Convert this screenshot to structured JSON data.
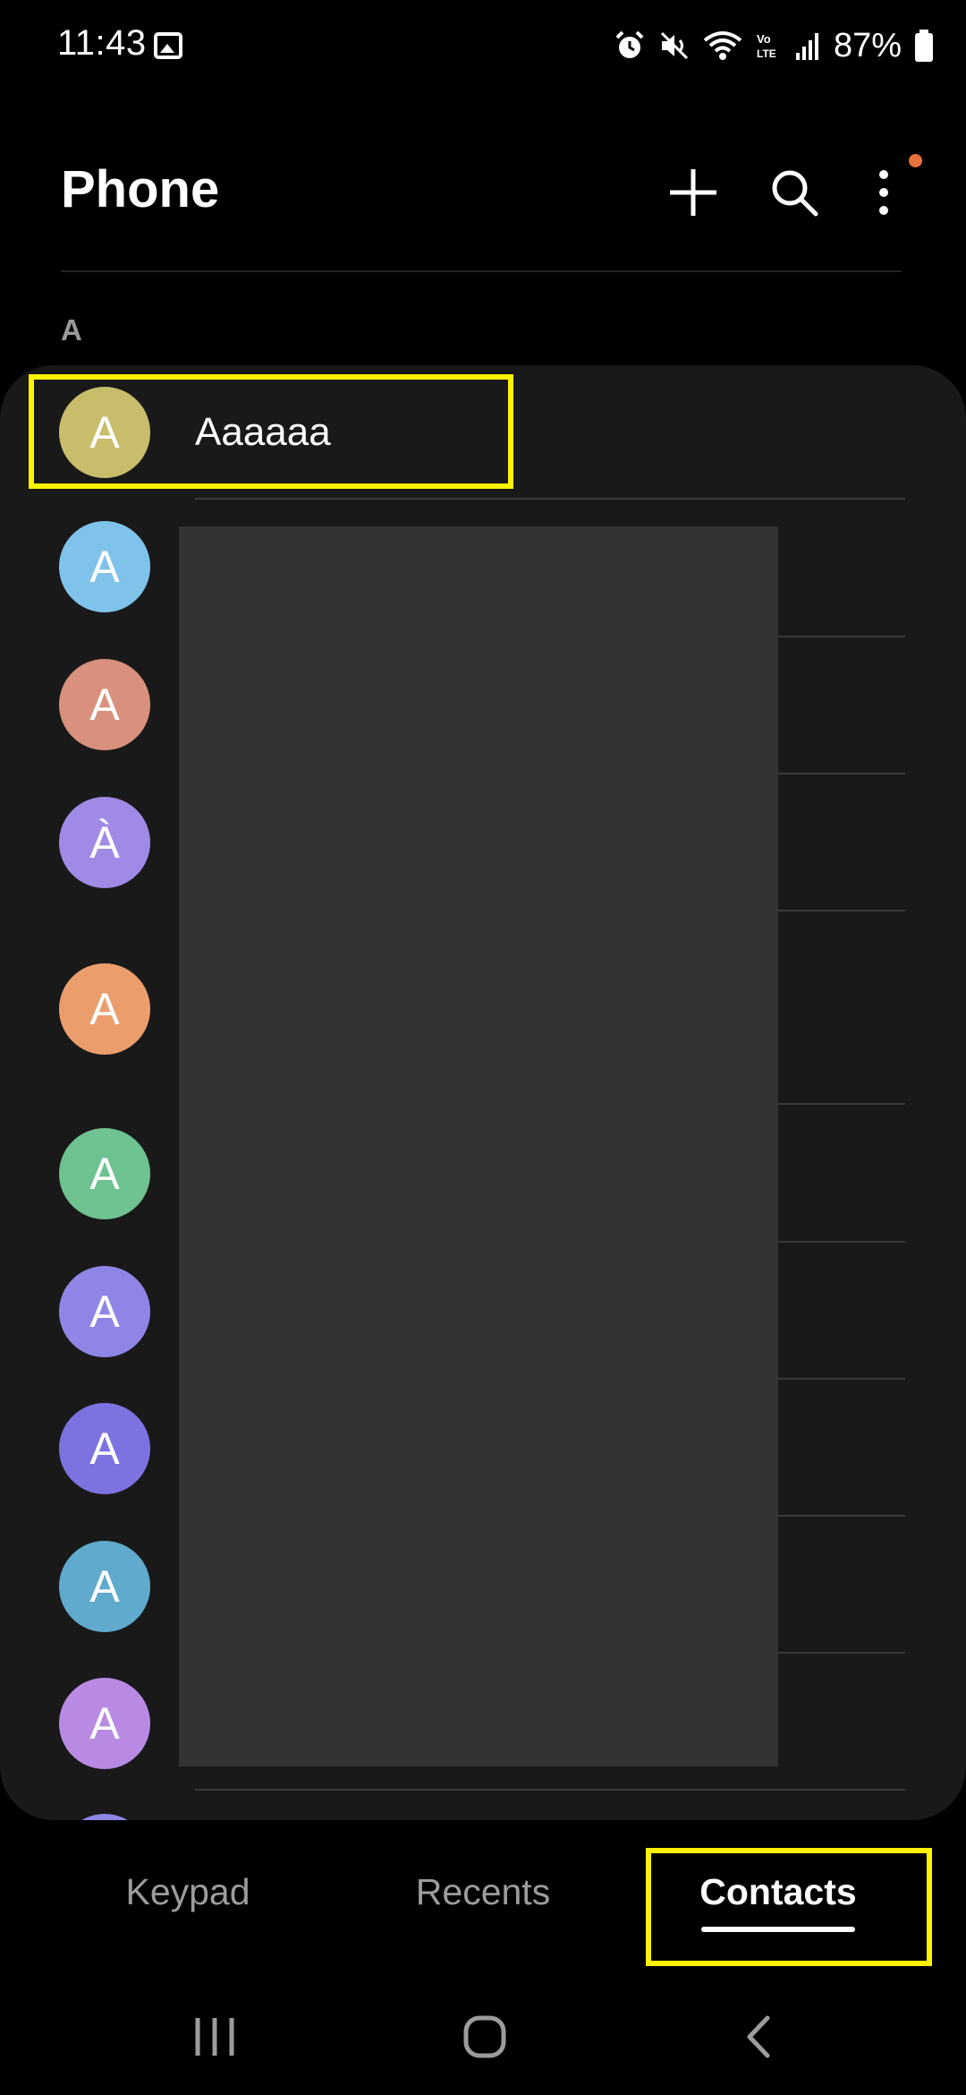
{
  "status_bar": {
    "time": "11:43",
    "battery": "87%",
    "icons": [
      "gallery-icon",
      "alarm-icon",
      "mute-icon",
      "wifi-icon",
      "volte-icon",
      "signal-icon",
      "battery-icon"
    ]
  },
  "header": {
    "title": "Phone",
    "actions": [
      "add-icon",
      "search-icon",
      "more-options-icon"
    ],
    "notification_dot_color": "#e8713c"
  },
  "section_letter": "A",
  "contacts": [
    {
      "initial": "A",
      "name": "Aaaaaa",
      "color": "#c7bd6a"
    },
    {
      "initial": "A",
      "name": "",
      "color": "#7fc3ea"
    },
    {
      "initial": "A",
      "name": "",
      "color": "#d9907c"
    },
    {
      "initial": "À",
      "name": "",
      "color": "#a08ae6"
    },
    {
      "initial": "A",
      "name": "",
      "color": "#eb9e6c"
    },
    {
      "initial": "A",
      "name": "",
      "color": "#6fc291"
    },
    {
      "initial": "A",
      "name": "",
      "color": "#8f85e6"
    },
    {
      "initial": "A",
      "name": "",
      "color": "#7c72e0"
    },
    {
      "initial": "A",
      "name": "",
      "color": "#5faacd"
    },
    {
      "initial": "A",
      "name": "",
      "color": "#b88ae3"
    }
  ],
  "tabs": [
    {
      "label": "Keypad",
      "selected": false
    },
    {
      "label": "Recents",
      "selected": false
    },
    {
      "label": "Contacts",
      "selected": true
    }
  ],
  "nav": [
    "recent-apps-icon",
    "home-icon",
    "back-icon"
  ],
  "colors": {
    "background": "#000000",
    "card": "#191919",
    "highlight": "#fff200",
    "redaction": "#333333"
  }
}
